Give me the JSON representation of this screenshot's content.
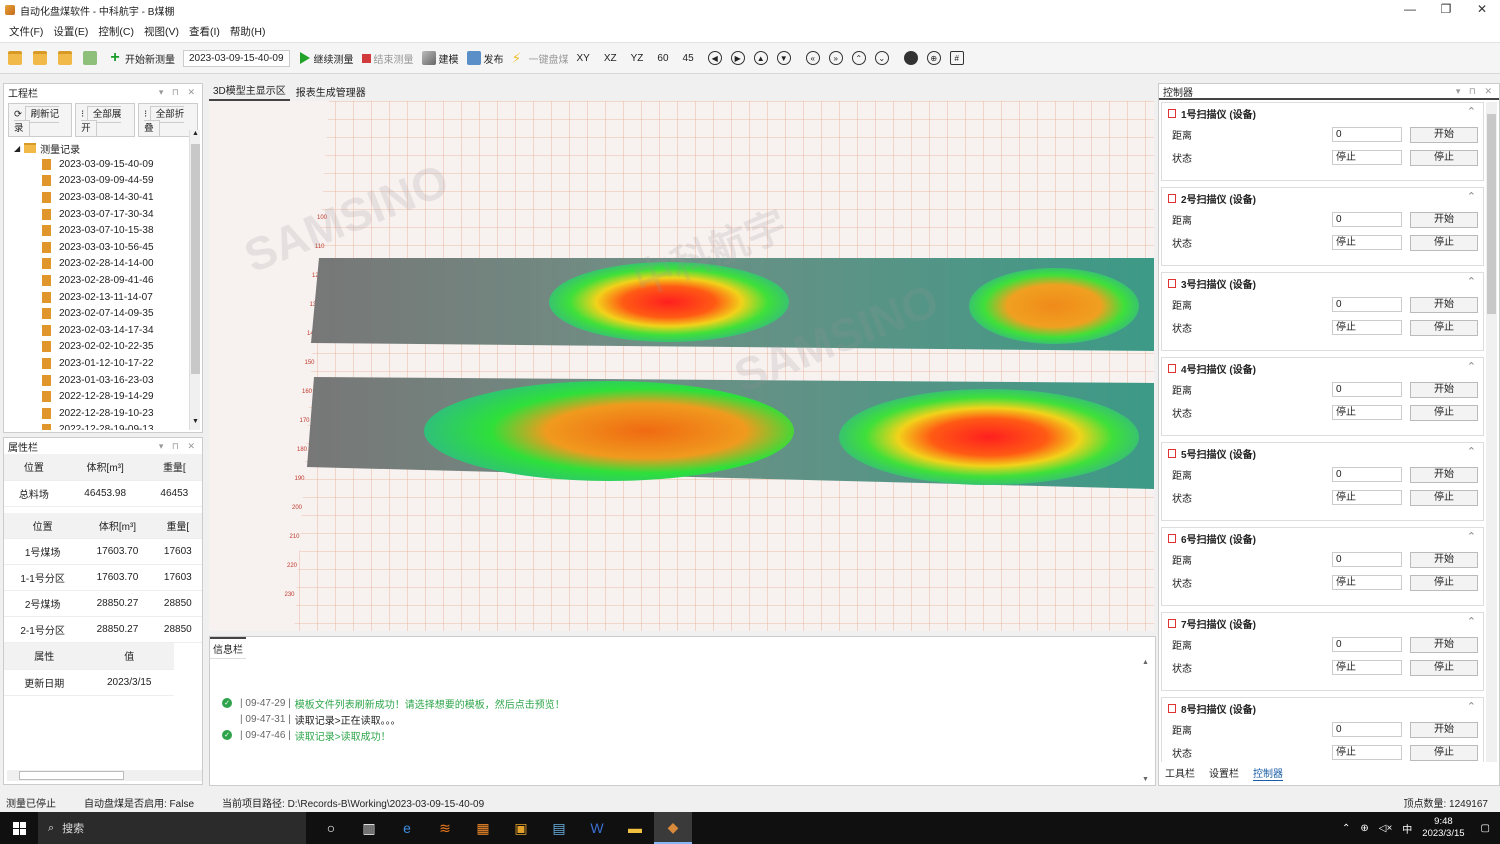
{
  "window": {
    "title": "自动化盘煤软件 - 中科航宇 - B煤棚",
    "minimize": "—",
    "maximize": "❐",
    "close": "✕"
  },
  "menu": [
    "文件(F)",
    "设置(E)",
    "控制(C)",
    "视图(V)",
    "查看(I)",
    "帮助(H)"
  ],
  "toolbar": {
    "start_measure": "开始新测量",
    "date": "2023-03-09-15-40-09",
    "continue": "继续测量",
    "end": "结束测量",
    "model": "建模",
    "publish": "发布",
    "one_key": "一键盘煤",
    "views": [
      "XY",
      "XZ",
      "YZ",
      "60",
      "45"
    ]
  },
  "project_panel": {
    "title": "工程栏",
    "buttons": [
      "刷新记录",
      "全部展开",
      "全部折叠"
    ],
    "root": "测量记录",
    "records": [
      "2023-03-09-15-40-09",
      "2023-03-09-09-44-59",
      "2023-03-08-14-30-41",
      "2023-03-07-17-30-34",
      "2023-03-07-10-15-38",
      "2023-03-03-10-56-45",
      "2023-02-28-14-14-00",
      "2023-02-28-09-41-46",
      "2023-02-13-11-14-07",
      "2023-02-07-14-09-35",
      "2023-02-03-14-17-34",
      "2023-02-02-10-22-35",
      "2023-01-12-10-17-22",
      "2023-01-03-16-23-03",
      "2022-12-28-19-14-29",
      "2022-12-28-19-10-23",
      "2022-12-28-19-09-13"
    ]
  },
  "attr_panel": {
    "title": "属性栏",
    "header1": [
      "位置",
      "体积[m³]",
      "重量["
    ],
    "rows1": [
      [
        "总料场",
        "46453.98",
        "46453"
      ]
    ],
    "header2": [
      "位置",
      "体积[m³]",
      "重量["
    ],
    "rows2": [
      [
        "1号煤场",
        "17603.70",
        "17603"
      ],
      [
        "1-1号分区",
        "17603.70",
        "17603"
      ],
      [
        "2号煤场",
        "28850.27",
        "28850"
      ],
      [
        "2-1号分区",
        "28850.27",
        "28850"
      ]
    ],
    "header3": [
      "属性",
      "值"
    ],
    "rows3": [
      [
        "更新日期",
        "2023/3/15"
      ]
    ]
  },
  "center": {
    "tabs": [
      "3D模型主显示区",
      "报表生成管理器"
    ],
    "y_ticks": [
      "100",
      "110",
      "120",
      "130",
      "140",
      "150",
      "160",
      "170",
      "180",
      "190",
      "200",
      "210",
      "220",
      "230"
    ]
  },
  "info": {
    "title": "信息栏",
    "logs": [
      {
        "ok": true,
        "time": "| 09-47-29 |",
        "text": "模板文件列表刷新成功！请选择想要的模板，然后点击预览！",
        "green": true
      },
      {
        "ok": false,
        "time": "| 09-47-31 |",
        "text": "读取记录>正在读取。。。",
        "green": false
      },
      {
        "ok": true,
        "time": "| 09-47-46 |",
        "text": "读取记录>读取成功！",
        "green": true
      }
    ]
  },
  "controller": {
    "title": "控制器",
    "labels": {
      "distance": "距离",
      "status": "状态",
      "start": "开始",
      "stop": "停止"
    },
    "devices": [
      {
        "name": "1号扫描仪 (设备)",
        "distance": "0",
        "status": "停止"
      },
      {
        "name": "2号扫描仪 (设备)",
        "distance": "0",
        "status": "停止"
      },
      {
        "name": "3号扫描仪 (设备)",
        "distance": "0",
        "status": "停止"
      },
      {
        "name": "4号扫描仪 (设备)",
        "distance": "0",
        "status": "停止"
      },
      {
        "name": "5号扫描仪 (设备)",
        "distance": "0",
        "status": "停止"
      },
      {
        "name": "6号扫描仪 (设备)",
        "distance": "0",
        "status": "停止"
      },
      {
        "name": "7号扫描仪 (设备)",
        "distance": "0",
        "status": "停止"
      },
      {
        "name": "8号扫描仪 (设备)",
        "distance": "0",
        "status": "停止"
      }
    ],
    "tabs": [
      "工具栏",
      "设置栏",
      "控制器"
    ]
  },
  "status": {
    "state": "测量已停止",
    "auto": "自动盘煤是否启用: False",
    "path": "当前项目路径:  D:\\Records-B\\Working\\2023-03-09-15-40-09",
    "points": "顶点数量: 1249167"
  },
  "taskbar": {
    "search": "搜索",
    "time": "9:48",
    "date": "2023/3/15",
    "ime": "中"
  },
  "watermark": {
    "text": "SAMSINO",
    "brand": "中科航宇"
  }
}
